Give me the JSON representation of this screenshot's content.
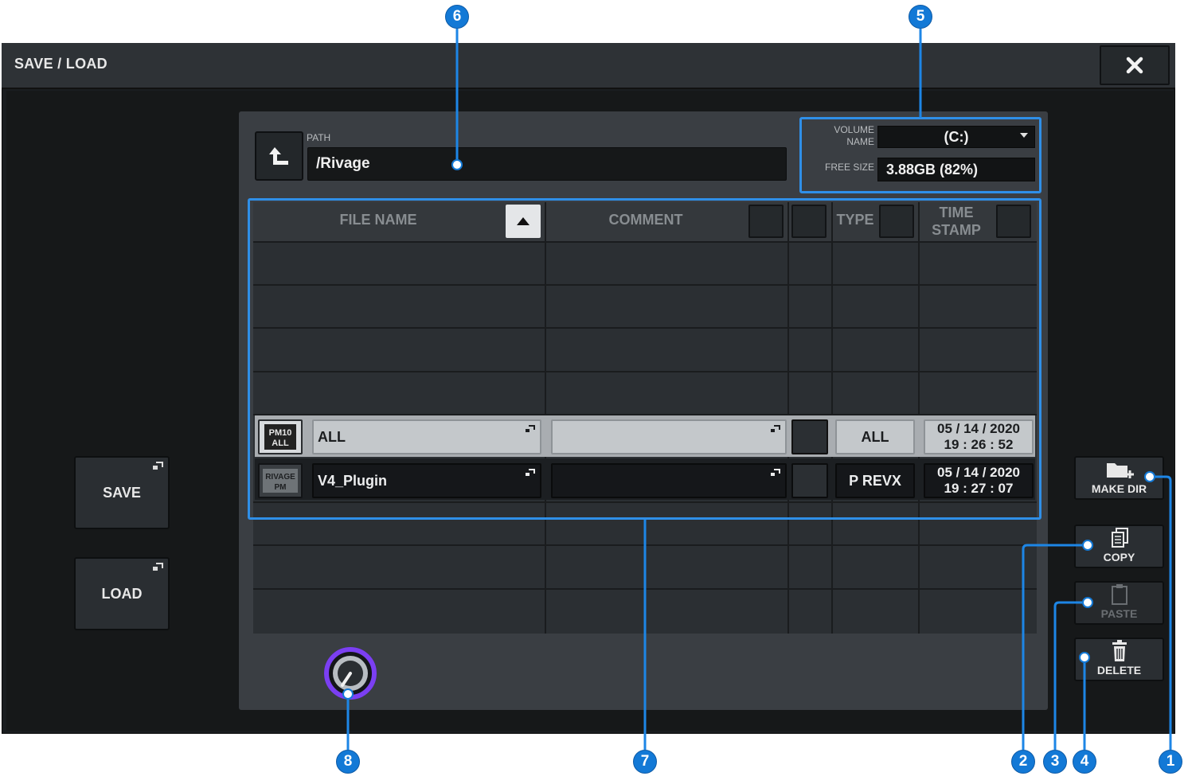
{
  "window": {
    "title": "SAVE / LOAD"
  },
  "left_buttons": {
    "save": "SAVE",
    "load": "LOAD"
  },
  "path": {
    "label": "PATH",
    "value": "/Rivage"
  },
  "volume": {
    "name_label": "VOLUME NAME",
    "name_value": "(C:)",
    "free_label": "FREE SIZE",
    "free_value": "3.88GB (82%)"
  },
  "columns": {
    "file_name": "FILE NAME",
    "comment": "COMMENT",
    "type": "TYPE",
    "time_stamp_1": "TIME",
    "time_stamp_2": "STAMP"
  },
  "files": [
    {
      "icon_line1": "PM10",
      "icon_line2": "ALL",
      "name": "ALL",
      "comment": "",
      "type": "ALL",
      "date": "05 / 14 / 2020",
      "time": "19 : 26 : 52",
      "selected": true
    },
    {
      "icon_line1": "RIVAGE",
      "icon_line2": "PM",
      "name": "V4_Plugin",
      "comment": "",
      "type": "P REVX",
      "date": "05 / 14 / 2020",
      "time": "19 : 27 : 07",
      "selected": false
    }
  ],
  "right_buttons": {
    "make_dir": "MAKE DIR",
    "copy": "COPY",
    "paste": "PASTE",
    "delete": "DELETE"
  },
  "callouts": [
    "1",
    "2",
    "3",
    "4",
    "5",
    "6",
    "7",
    "8"
  ],
  "colors": {
    "accent": "#2f8fe8",
    "callout": "#1379d6",
    "knob_ring": "#7b3ff2"
  }
}
